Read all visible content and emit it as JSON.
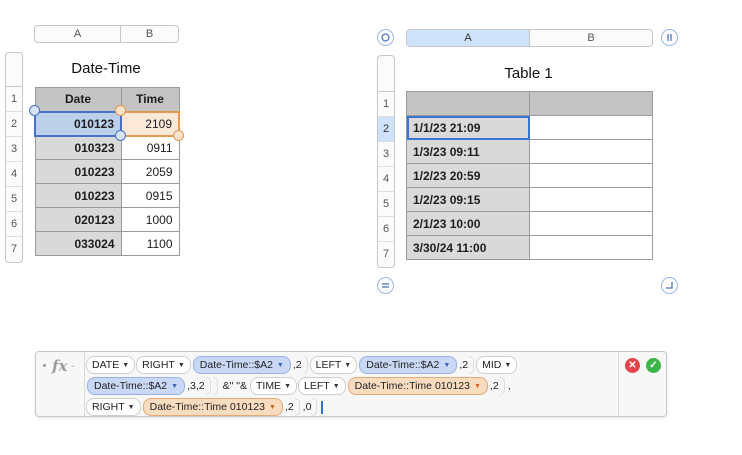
{
  "table1": {
    "title": "Date-Time",
    "columns": [
      "A",
      "B"
    ],
    "rows": [
      "1",
      "2",
      "3",
      "4",
      "5",
      "6",
      "7"
    ],
    "header": [
      "Date",
      "Time"
    ],
    "data": [
      [
        "010123",
        "2109"
      ],
      [
        "010323",
        "0911"
      ],
      [
        "010223",
        "2059"
      ],
      [
        "010223",
        "0915"
      ],
      [
        "020123",
        "1000"
      ],
      [
        "033024",
        "1100"
      ]
    ]
  },
  "table2": {
    "title": "Table 1",
    "columns": [
      "A",
      "B"
    ],
    "rows": [
      "1",
      "2",
      "3",
      "4",
      "5",
      "6",
      "7"
    ],
    "data": [
      "1/1/23 21:09",
      "1/3/23 09:11",
      "1/2/23 20:59",
      "1/2/23 09:15",
      "2/1/23 10:00",
      "3/30/24 11:00"
    ]
  },
  "formula_bar": {
    "fx_label": "fx",
    "line1": {
      "date_fn": "DATE",
      "right_fn": "RIGHT",
      "ref_a2_1": "Date-Time::$A2",
      "arg_2a": ",2",
      "left_fn": "LEFT",
      "ref_a2_2": "Date-Time::$A2",
      "arg_2b": ",2",
      "mid_fn": "MID"
    },
    "line2": {
      "ref_a2_3": "Date-Time::$A2",
      "arg_32": ",3,2",
      "concat_text": "&\" \"&",
      "time_fn": "TIME",
      "left_fn": "LEFT",
      "ref_time_1": "Date-Time::Time 010123",
      "arg_2": ",2",
      "trail": ","
    },
    "line3": {
      "right_fn": "RIGHT",
      "ref_time_2": "Date-Time::Time 010123",
      "arg_2": ",2",
      "arg_0": ",0"
    },
    "cancel_symbol": "✕",
    "accept_symbol": "✓"
  },
  "colors": {
    "selection_blue": "#4a72c4",
    "reference_orange": "#e39a52",
    "cancel_red": "#e5454a",
    "accept_green": "#3cb54a"
  }
}
